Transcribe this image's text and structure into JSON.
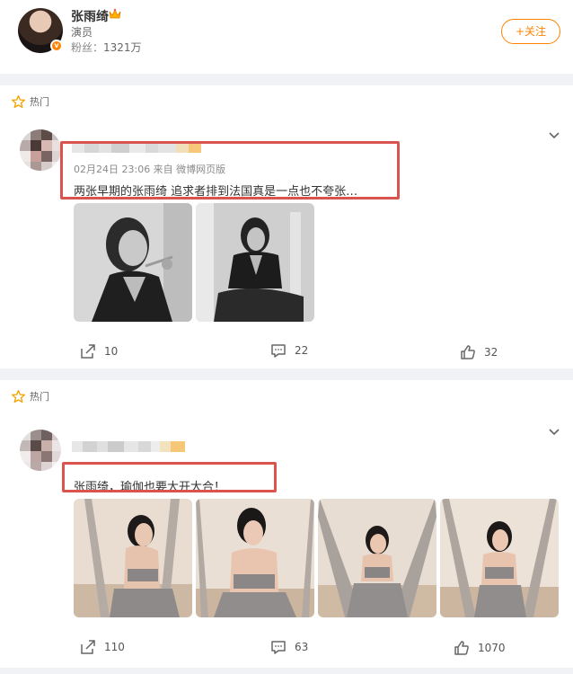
{
  "profile": {
    "name": "张雨绮",
    "role": "演员",
    "fans_label": "粉丝：",
    "fans_count": "1321万",
    "follow_label": "+关注"
  },
  "posts": [
    {
      "hot_label": "热门",
      "meta": "02月24日 23:06  来自 微博网页版",
      "text": "两张早期的张雨绮 追求者排到法国真是一点也不夸张…",
      "photos": [
        "black-white-portrait-smoking",
        "black-white-portrait-sitting"
      ],
      "actions": {
        "repost": "10",
        "comment": "22",
        "like": "32"
      }
    },
    {
      "hot_label": "热门",
      "text": "张雨绮，瑜伽也要大开大合！",
      "photos": [
        "yoga-hammock-back-view",
        "yoga-hammock-front-view",
        "yoga-hammock-seated",
        "yoga-hammock-standing"
      ],
      "actions": {
        "repost": "110",
        "comment": "63",
        "like": "1070"
      }
    }
  ],
  "colors": {
    "accent": "#ff8200",
    "highlight": "#d9534f",
    "background": "#f1f2f5"
  },
  "icons": [
    "crown-icon",
    "verified-icon",
    "hot-star-icon",
    "chevron-down-icon",
    "repost-icon",
    "comment-icon",
    "like-icon"
  ]
}
